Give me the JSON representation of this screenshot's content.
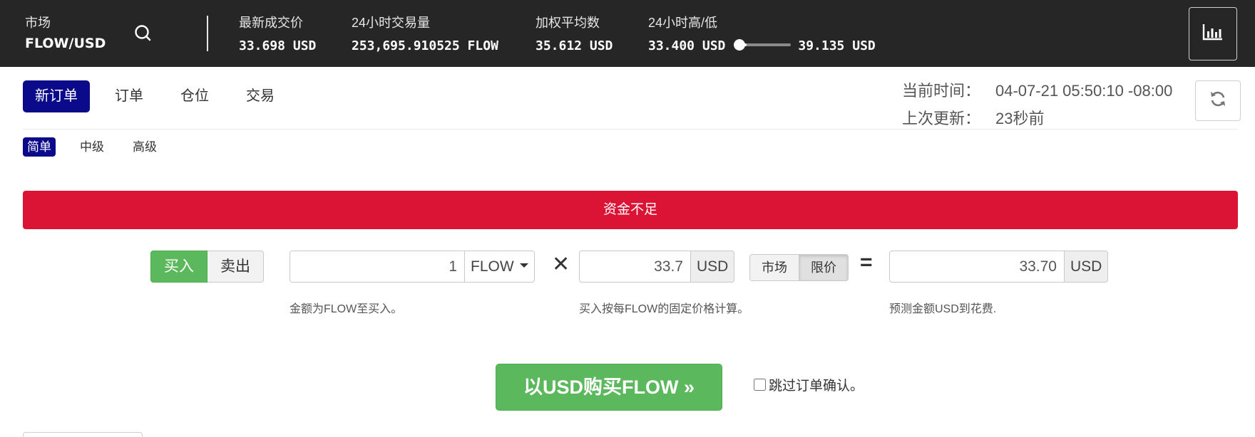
{
  "topbar": {
    "market_label": "市场",
    "market_value": "FLOW/USD",
    "last_price_label": "最新成交价",
    "last_price_value": "33.698 USD",
    "volume_label": "24小时交易量",
    "volume_value": "253,695.910525 FLOW",
    "vwap_label": "加权平均数",
    "vwap_value": "35.612 USD",
    "highlow_label": "24小时高/低",
    "low_value": "33.400 USD",
    "high_value": "39.135 USD",
    "range_position": 0.05,
    "icons": {
      "search": "search-icon",
      "chart": "bar-chart-icon"
    }
  },
  "tabs": {
    "items": [
      "新订单",
      "订单",
      "仓位",
      "交易"
    ],
    "active": "新订单"
  },
  "time": {
    "current_label": "当前时间：",
    "current_value": "04-07-21 05:50:10 -08:00",
    "updated_label": "上次更新：",
    "updated_value": "23秒前",
    "refresh_icon": "refresh-icon"
  },
  "subtabs": {
    "items": [
      "简单",
      "中级",
      "高级"
    ],
    "active": "简单"
  },
  "alert": {
    "text": "资金不足",
    "color": "#db1335"
  },
  "form": {
    "side_buy": "买入",
    "side_sell": "卖出",
    "amount_value": "1",
    "amount_unit": "FLOW",
    "multiply": "✕",
    "price_value": "33.7",
    "price_unit": "USD",
    "type_market": "市场",
    "type_limit": "限价",
    "equals": "=",
    "total_value": "33.70",
    "total_unit": "USD",
    "amount_help": "金额为FLOW至买入。",
    "price_help": "买入按每FLOW的固定价格计算。",
    "total_help": "预测金额USD到花费."
  },
  "submit": {
    "label": "以USD购买FLOW »",
    "color": "#5cb85c"
  },
  "skip_confirm": {
    "label": "跳过订单确认。",
    "checked": false
  }
}
